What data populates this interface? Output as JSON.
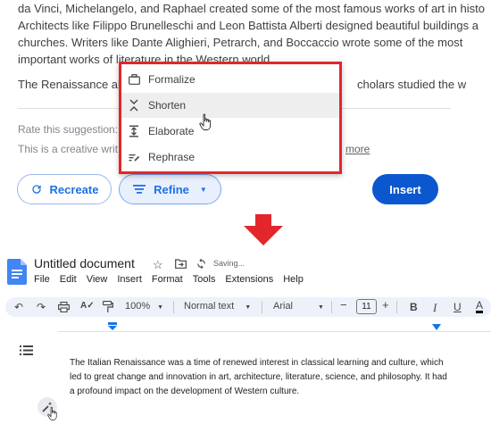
{
  "suggestion_panel": {
    "paragraph_lines": [
      "da Vinci, Michelangelo, and Raphael created some of the most famous works of art in histo",
      "Architects like Filippo Brunelleschi and Leon Battista Alberti designed beautiful buildings a",
      "churches. Writers like Dante Alighieri, Petrarch, and Boccaccio wrote some of the most",
      "important works of literature in the Western world."
    ],
    "paragraph2_start": "The Renaissance also",
    "paragraph2_end": "cholars studied the w",
    "rate_text": "Rate this suggestion:",
    "desc_start": "This is a creative writ",
    "learn_more_fragment": "more",
    "refine_menu": {
      "items": [
        {
          "label": "Formalize",
          "icon": "briefcase-icon"
        },
        {
          "label": "Shorten",
          "icon": "shorten-icon"
        },
        {
          "label": "Elaborate",
          "icon": "elaborate-icon"
        },
        {
          "label": "Rephrase",
          "icon": "rephrase-icon"
        }
      ],
      "hovered_index": 1
    },
    "buttons": {
      "recreate": "Recreate",
      "refine": "Refine",
      "insert": "Insert"
    }
  },
  "docs": {
    "title": "Untitled document",
    "saving_status": "Saving...",
    "menu": [
      "File",
      "Edit",
      "View",
      "Insert",
      "Format",
      "Tools",
      "Extensions",
      "Help"
    ],
    "toolbar": {
      "zoom": "100%",
      "style": "Normal text",
      "font": "Arial",
      "font_size": "11"
    },
    "body_lines": [
      "The Italian Renaissance was a time of renewed interest in classical learning and culture, which",
      "led to great change and innovation in art, architecture, literature, science, and philosophy. It had",
      "a profound impact on the development of Western culture."
    ]
  },
  "colors": {
    "highlight_border": "#e3262b",
    "primary_blue": "#0b57d0",
    "arrow_red": "#e3262b",
    "docs_blue": "#4285f4"
  }
}
